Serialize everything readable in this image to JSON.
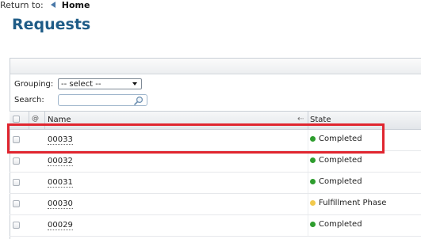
{
  "header": {
    "return_label": "Return to:",
    "home_label": "Home",
    "page_title": "Requests"
  },
  "filters": {
    "grouping_label": "Grouping:",
    "grouping_value": "-- select --",
    "search_label": "Search:",
    "search_value": "",
    "search_placeholder": ""
  },
  "grid": {
    "columns": {
      "attachment": "@",
      "name": "Name",
      "state": "State"
    },
    "rows": [
      {
        "name": "00033",
        "state": "Completed",
        "state_color": "#2e9d2e",
        "highlighted": true
      },
      {
        "name": "00032",
        "state": "Completed",
        "state_color": "#2e9d2e"
      },
      {
        "name": "00031",
        "state": "Completed",
        "state_color": "#2e9d2e"
      },
      {
        "name": "00030",
        "state": "Fulfillment Phase",
        "state_color": "#f2c94c"
      },
      {
        "name": "00029",
        "state": "Completed",
        "state_color": "#2e9d2e"
      }
    ]
  },
  "colors": {
    "title": "#1f5c87",
    "highlight_box": "#e0252f"
  }
}
